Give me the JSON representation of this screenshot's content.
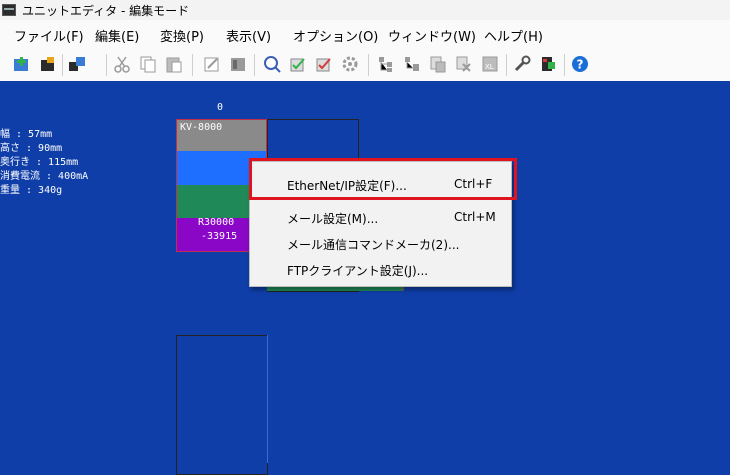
{
  "window": {
    "title": "ユニットエディタ - 編集モード",
    "icon": "app-window-icon"
  },
  "menubar": {
    "items": [
      "ファイル(F)",
      "編集(E)",
      "変換(P)",
      "表示(V)",
      "オプション(O)",
      "ウィンドウ(W)",
      "ヘルプ(H)"
    ]
  },
  "toolbar": {
    "icons": [
      "insert-unit-icon",
      "edit-unit-icon",
      "transfer-icon",
      "cut-icon",
      "copy-icon",
      "paste-icon",
      "edit-icon",
      "unit-list-icon",
      "search-icon",
      "check-icon",
      "verify-icon",
      "settings-gear-icon",
      "tree-icon",
      "tree-config-icon",
      "copy-config-icon",
      "delete-config-icon",
      "xl-export-icon",
      "wrench-icon",
      "device-icon",
      "help-icon"
    ],
    "accent": "#1a6fd6"
  },
  "canvas": {
    "background": "#0f3ea8",
    "specs": [
      "幅 : 57mm",
      "高さ : 90mm",
      "奥行き : 115mm",
      "消費電流 : 400mA",
      "重量 : 340g"
    ],
    "slot_number": "0",
    "unit": {
      "name": "KV-8000",
      "line1": "R30000",
      "line2": "-33915",
      "colors": {
        "gray": "#8a8a8a",
        "blue": "#1e6fff",
        "green": "#1f8a57",
        "purple": "#8b07c8"
      }
    }
  },
  "context_menu": {
    "items": [
      {
        "label": "EtherNet/IP設定(F)...",
        "shortcut": "Ctrl+F"
      },
      {
        "label": "メール設定(M)...",
        "shortcut": "Ctrl+M"
      },
      {
        "label": "メール通信コマンドメーカ(2)...",
        "shortcut": ""
      },
      {
        "label": "FTPクライアント設定(J)...",
        "shortcut": ""
      }
    ],
    "highlight_color": "#e0141e"
  }
}
